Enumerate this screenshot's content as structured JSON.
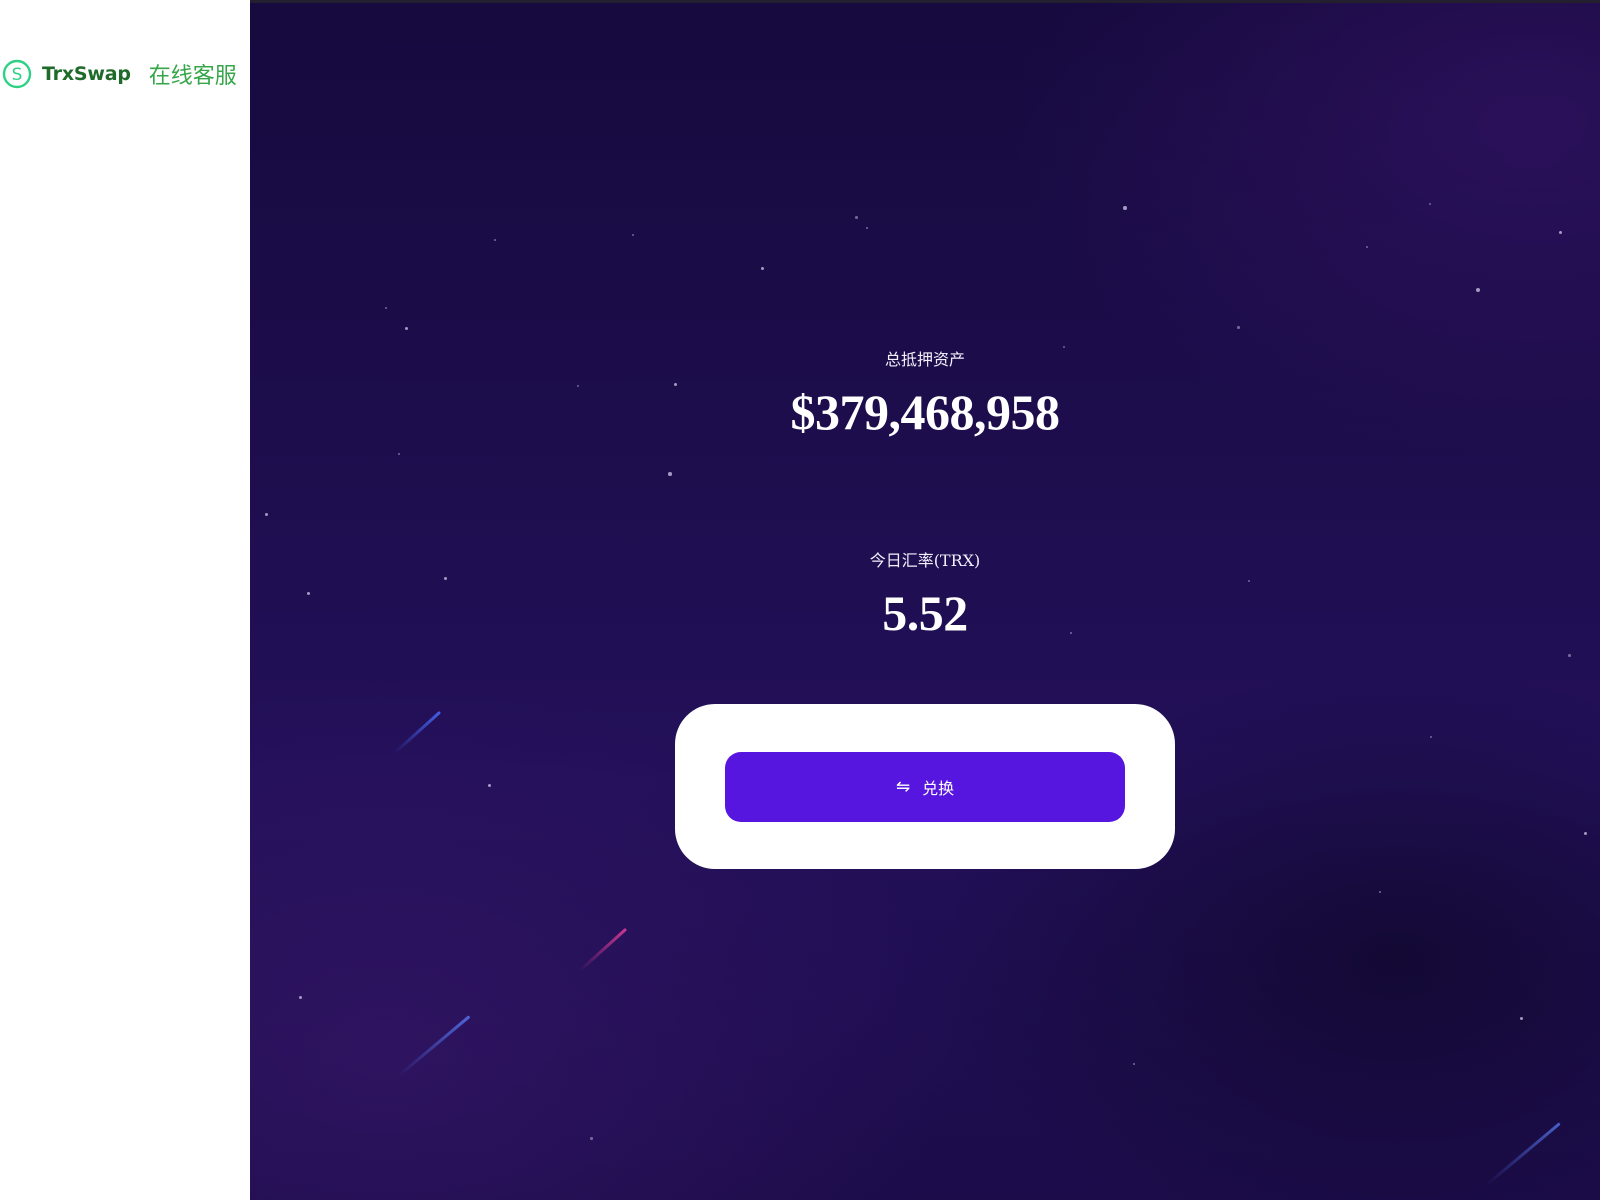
{
  "sidebar": {
    "brand_name": "TrxSwap",
    "support_link": "在线客服",
    "logo_icon": "dollar-coin-icon",
    "colors": {
      "brand_text": "#1f6b2a",
      "link": "#37a64a",
      "logo": "#2fd184"
    }
  },
  "main": {
    "total_collateral": {
      "label": "总抵押资产",
      "value": "$379,468,958"
    },
    "exchange_rate": {
      "label": "今日汇率(TRX)",
      "value": "5.52"
    },
    "swap": {
      "button_label": "兑换",
      "button_icon": "swap-arrows-icon",
      "button_icon_glyph": "⇋"
    },
    "colors": {
      "background": "#1d0d4c",
      "button": "#5616e0",
      "card": "#ffffff"
    }
  }
}
